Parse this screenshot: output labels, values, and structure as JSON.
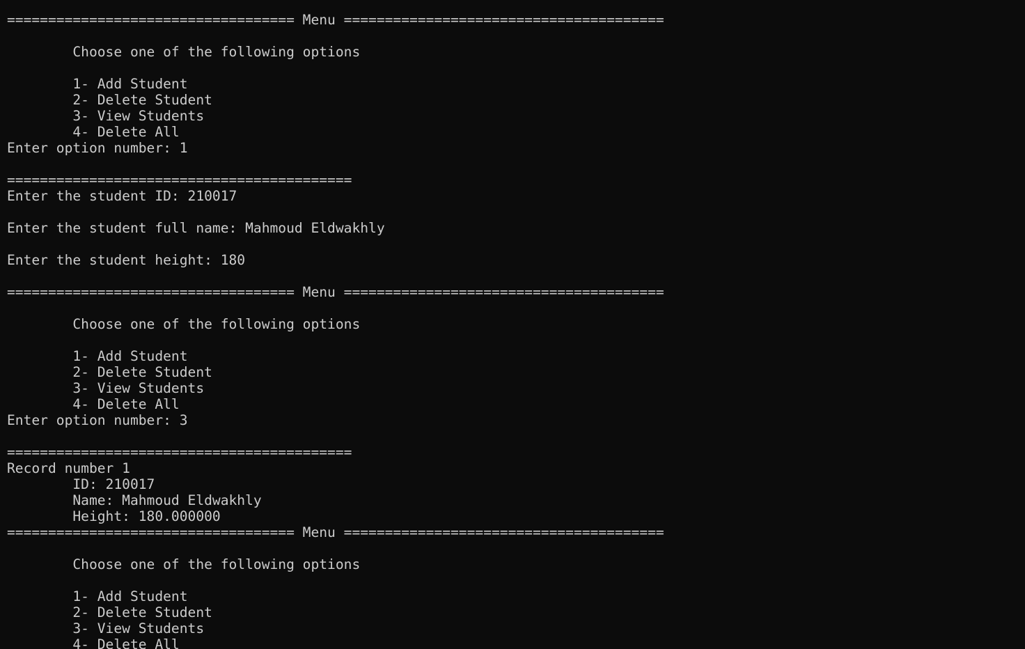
{
  "console": {
    "lines": [
      "=================================== Menu =======================================",
      "",
      "        Choose one of the following options",
      "",
      "        1- Add Student",
      "        2- Delete Student",
      "        3- View Students",
      "        4- Delete All",
      "Enter option number: 1",
      "",
      "==========================================",
      "Enter the student ID: 210017",
      "",
      "Enter the student full name: Mahmoud Eldwakhly",
      "",
      "Enter the student height: 180",
      "",
      "=================================== Menu =======================================",
      "",
      "        Choose one of the following options",
      "",
      "        1- Add Student",
      "        2- Delete Student",
      "        3- View Students",
      "        4- Delete All",
      "Enter option number: 3",
      "",
      "==========================================",
      "Record number 1",
      "        ID: 210017",
      "        Name: Mahmoud Eldwakhly",
      "        Height: 180.000000",
      "=================================== Menu =======================================",
      "",
      "        Choose one of the following options",
      "",
      "        1- Add Student",
      "        2- Delete Student",
      "        3- View Students",
      "        4- Delete All"
    ]
  }
}
